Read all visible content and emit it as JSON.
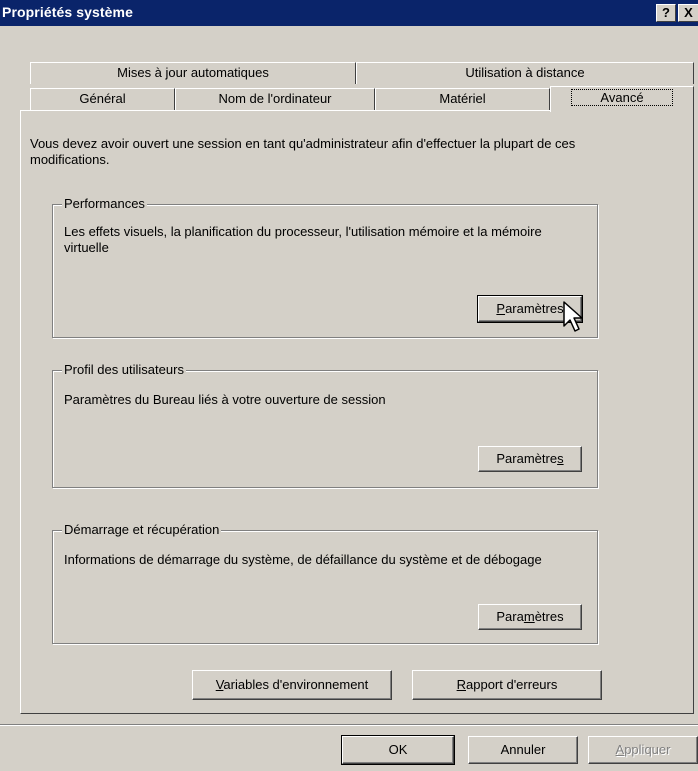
{
  "window": {
    "title": "Propriétés système",
    "help_glyph": "?",
    "close_glyph": "X"
  },
  "tabs": {
    "row1": [
      "Mises à jour automatiques",
      "Utilisation à distance"
    ],
    "row2": [
      "Général",
      "Nom de l'ordinateur",
      "Matériel",
      "Avancé"
    ],
    "active": "Avancé"
  },
  "admin_note": "Vous devez avoir ouvert une session en tant qu'administrateur afin d'effectuer la plupart de ces modifications.",
  "performances": {
    "legend": "Performances",
    "description": "Les effets visuels, la planification du processeur, l'utilisation mémoire et la mémoire virtuelle",
    "button": {
      "mnemonic": "P",
      "rest": "aramètres"
    }
  },
  "user_profiles": {
    "legend": "Profil des utilisateurs",
    "description": "Paramètres du Bureau liés à votre ouverture de session",
    "button": {
      "before": "Paramètre",
      "mnemonic": "s",
      "after": ""
    }
  },
  "startup_recovery": {
    "legend": "Démarrage et récupération",
    "description": "Informations de démarrage du système, de défaillance du système et de débogage",
    "button": {
      "before": "Para",
      "mnemonic": "m",
      "after": "ètres"
    }
  },
  "env_button": {
    "mnemonic": "V",
    "rest": "ariables d'environnement"
  },
  "report_button": {
    "mnemonic": "R",
    "rest": "apport d'erreurs"
  },
  "footer": {
    "ok": "OK",
    "cancel": "Annuler",
    "apply": {
      "mnemonic": "A",
      "rest": "ppliquer"
    }
  }
}
